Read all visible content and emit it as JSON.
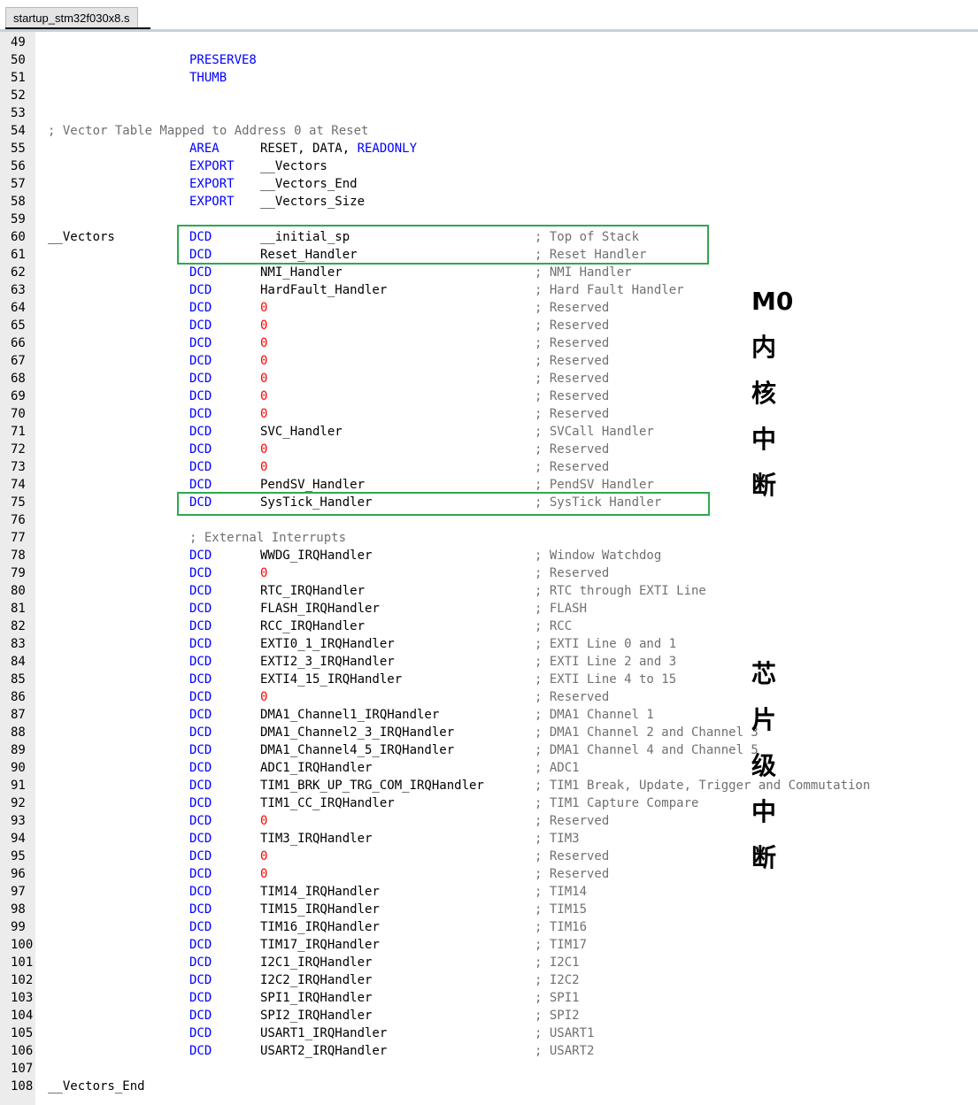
{
  "tab": {
    "label": "startup_stm32f030x8.s"
  },
  "lines": [
    {
      "n": "49"
    },
    {
      "n": "50",
      "dir": "PRESERVE8"
    },
    {
      "n": "51",
      "dir": "THUMB"
    },
    {
      "n": "52"
    },
    {
      "n": "53"
    },
    {
      "n": "54",
      "fullcomment": "; Vector Table Mapped to Address 0 at Reset"
    },
    {
      "n": "55",
      "dir": "AREA",
      "op": "RESET, DATA, ",
      "opkw": "READONLY"
    },
    {
      "n": "56",
      "dir": "EXPORT",
      "op": "__Vectors"
    },
    {
      "n": "57",
      "dir": "EXPORT",
      "op": "__Vectors_End"
    },
    {
      "n": "58",
      "dir": "EXPORT",
      "op": "__Vectors_Size"
    },
    {
      "n": "59"
    },
    {
      "n": "60",
      "label": "__Vectors",
      "dir": "DCD",
      "op": "__initial_sp",
      "comment": "; Top of Stack"
    },
    {
      "n": "61",
      "dir": "DCD",
      "op": "Reset_Handler",
      "comment": "; Reset Handler"
    },
    {
      "n": "62",
      "dir": "DCD",
      "op": "NMI_Handler",
      "comment": "; NMI Handler"
    },
    {
      "n": "63",
      "dir": "DCD",
      "op": "HardFault_Handler",
      "comment": "; Hard Fault Handler"
    },
    {
      "n": "64",
      "dir": "DCD",
      "op": "0",
      "comment": "; Reserved"
    },
    {
      "n": "65",
      "dir": "DCD",
      "op": "0",
      "comment": "; Reserved"
    },
    {
      "n": "66",
      "dir": "DCD",
      "op": "0",
      "comment": "; Reserved"
    },
    {
      "n": "67",
      "dir": "DCD",
      "op": "0",
      "comment": "; Reserved"
    },
    {
      "n": "68",
      "dir": "DCD",
      "op": "0",
      "comment": "; Reserved"
    },
    {
      "n": "69",
      "dir": "DCD",
      "op": "0",
      "comment": "; Reserved"
    },
    {
      "n": "70",
      "dir": "DCD",
      "op": "0",
      "comment": "; Reserved"
    },
    {
      "n": "71",
      "dir": "DCD",
      "op": "SVC_Handler",
      "comment": "; SVCall Handler"
    },
    {
      "n": "72",
      "dir": "DCD",
      "op": "0",
      "comment": "; Reserved"
    },
    {
      "n": "73",
      "dir": "DCD",
      "op": "0",
      "comment": "; Reserved"
    },
    {
      "n": "74",
      "dir": "DCD",
      "op": "PendSV_Handler",
      "comment": "; PendSV Handler"
    },
    {
      "n": "75",
      "dir": "DCD",
      "op": "SysTick_Handler",
      "comment": "; SysTick Handler"
    },
    {
      "n": "76"
    },
    {
      "n": "77",
      "blockcomment": "; External Interrupts"
    },
    {
      "n": "78",
      "dir": "DCD",
      "op": "WWDG_IRQHandler",
      "comment": "; Window Watchdog"
    },
    {
      "n": "79",
      "dir": "DCD",
      "op": "0",
      "comment": "; Reserved"
    },
    {
      "n": "80",
      "dir": "DCD",
      "op": "RTC_IRQHandler",
      "comment": "; RTC through EXTI Line"
    },
    {
      "n": "81",
      "dir": "DCD",
      "op": "FLASH_IRQHandler",
      "comment": "; FLASH"
    },
    {
      "n": "82",
      "dir": "DCD",
      "op": "RCC_IRQHandler",
      "comment": "; RCC"
    },
    {
      "n": "83",
      "dir": "DCD",
      "op": "EXTI0_1_IRQHandler",
      "comment": "; EXTI Line 0 and 1"
    },
    {
      "n": "84",
      "dir": "DCD",
      "op": "EXTI2_3_IRQHandler",
      "comment": "; EXTI Line 2 and 3"
    },
    {
      "n": "85",
      "dir": "DCD",
      "op": "EXTI4_15_IRQHandler",
      "comment": "; EXTI Line 4 to 15"
    },
    {
      "n": "86",
      "dir": "DCD",
      "op": "0",
      "comment": "; Reserved"
    },
    {
      "n": "87",
      "dir": "DCD",
      "op": "DMA1_Channel1_IRQHandler",
      "comment": "; DMA1 Channel 1"
    },
    {
      "n": "88",
      "dir": "DCD",
      "op": "DMA1_Channel2_3_IRQHandler",
      "comment": "; DMA1 Channel 2 and Channel 3"
    },
    {
      "n": "89",
      "dir": "DCD",
      "op": "DMA1_Channel4_5_IRQHandler",
      "comment": "; DMA1 Channel 4 and Channel 5"
    },
    {
      "n": "90",
      "dir": "DCD",
      "op": "ADC1_IRQHandler",
      "comment": "; ADC1"
    },
    {
      "n": "91",
      "dir": "DCD",
      "op": "TIM1_BRK_UP_TRG_COM_IRQHandler",
      "comment": "; TIM1 Break, Update, Trigger and Commutation"
    },
    {
      "n": "92",
      "dir": "DCD",
      "op": "TIM1_CC_IRQHandler",
      "comment": "; TIM1 Capture Compare"
    },
    {
      "n": "93",
      "dir": "DCD",
      "op": "0",
      "comment": "; Reserved"
    },
    {
      "n": "94",
      "dir": "DCD",
      "op": "TIM3_IRQHandler",
      "comment": "; TIM3"
    },
    {
      "n": "95",
      "dir": "DCD",
      "op": "0",
      "comment": "; Reserved"
    },
    {
      "n": "96",
      "dir": "DCD",
      "op": "0",
      "comment": "; Reserved"
    },
    {
      "n": "97",
      "dir": "DCD",
      "op": "TIM14_IRQHandler",
      "comment": "; TIM14"
    },
    {
      "n": "98",
      "dir": "DCD",
      "op": "TIM15_IRQHandler",
      "comment": "; TIM15"
    },
    {
      "n": "99",
      "dir": "DCD",
      "op": "TIM16_IRQHandler",
      "comment": "; TIM16"
    },
    {
      "n": "100",
      "dir": "DCD",
      "op": "TIM17_IRQHandler",
      "comment": "; TIM17"
    },
    {
      "n": "101",
      "dir": "DCD",
      "op": "I2C1_IRQHandler",
      "comment": "; I2C1"
    },
    {
      "n": "102",
      "dir": "DCD",
      "op": "I2C2_IRQHandler",
      "comment": "; I2C2"
    },
    {
      "n": "103",
      "dir": "DCD",
      "op": "SPI1_IRQHandler",
      "comment": "; SPI1"
    },
    {
      "n": "104",
      "dir": "DCD",
      "op": "SPI2_IRQHandler",
      "comment": "; SPI2"
    },
    {
      "n": "105",
      "dir": "DCD",
      "op": "USART1_IRQHandler",
      "comment": "; USART1"
    },
    {
      "n": "106",
      "dir": "DCD",
      "op": "USART2_IRQHandler",
      "comment": "; USART2"
    },
    {
      "n": "107"
    },
    {
      "n": "108",
      "label": "__Vectors_End"
    }
  ],
  "annotations": {
    "core": [
      "M0",
      "内",
      "核",
      "中",
      "断"
    ],
    "chip": [
      "芯",
      "片",
      "级",
      "中",
      "断"
    ]
  },
  "colors": {
    "directive": "#0000ff",
    "zero_value": "#ff0000",
    "comment": "#707070",
    "highlight_box": "#2fa84f"
  }
}
